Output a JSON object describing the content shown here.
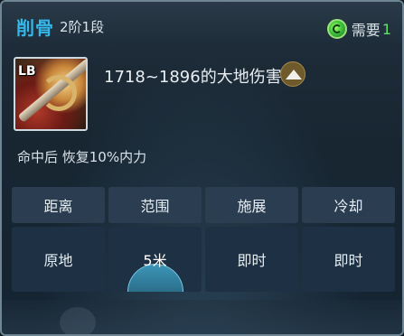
{
  "skill": {
    "name": "削骨",
    "tier": "2阶1段",
    "key_badge": "LB",
    "damage_text": "1718~1896的大地伤害",
    "damage_element_icon": "mountain-icon",
    "effect_text": "命中后 恢复10%内力"
  },
  "requirement": {
    "label": "需要",
    "value": "1",
    "icon": "green-spiral-icon",
    "value_color": "#5fe06a"
  },
  "stats": {
    "headers": [
      "距离",
      "范围",
      "施展",
      "冷却"
    ],
    "values": [
      "原地",
      "5米",
      "即时",
      "即时"
    ]
  },
  "colors": {
    "skill_name": "#35b7ea",
    "range_highlight": "#3c95b8"
  }
}
